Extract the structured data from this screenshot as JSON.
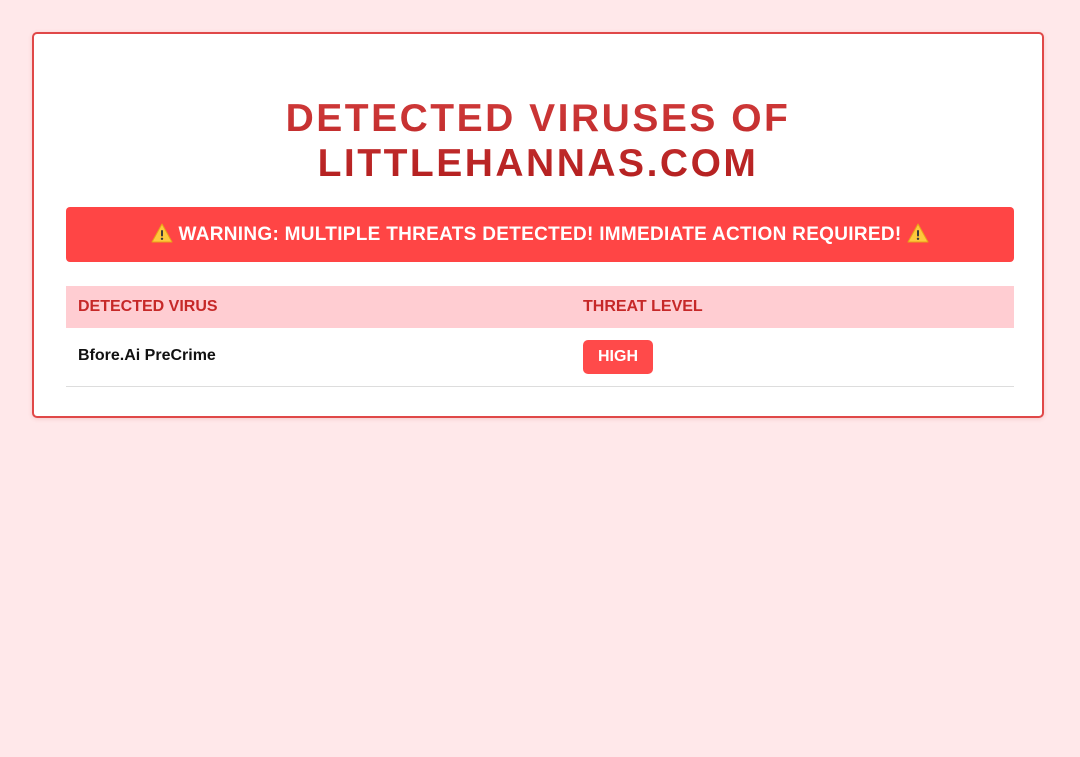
{
  "page": {
    "title_line1": "DETECTED VIRUSES OF",
    "title_line2": "LITTLEHANNAS.COM"
  },
  "warning": {
    "icon": "warning-icon",
    "text": "WARNING: MULTIPLE THREATS DETECTED! IMMEDIATE ACTION REQUIRED!"
  },
  "table": {
    "headers": [
      "DETECTED VIRUS",
      "THREAT LEVEL"
    ],
    "rows": [
      {
        "virus": "Bfore.Ai PreCrime",
        "threat_level": "HIGH"
      }
    ]
  },
  "colors": {
    "background": "#ffe8ea",
    "accent": "#ff4545",
    "title": "#c0292b",
    "header_bg": "#ffcdd2",
    "header_text": "#c62828"
  }
}
